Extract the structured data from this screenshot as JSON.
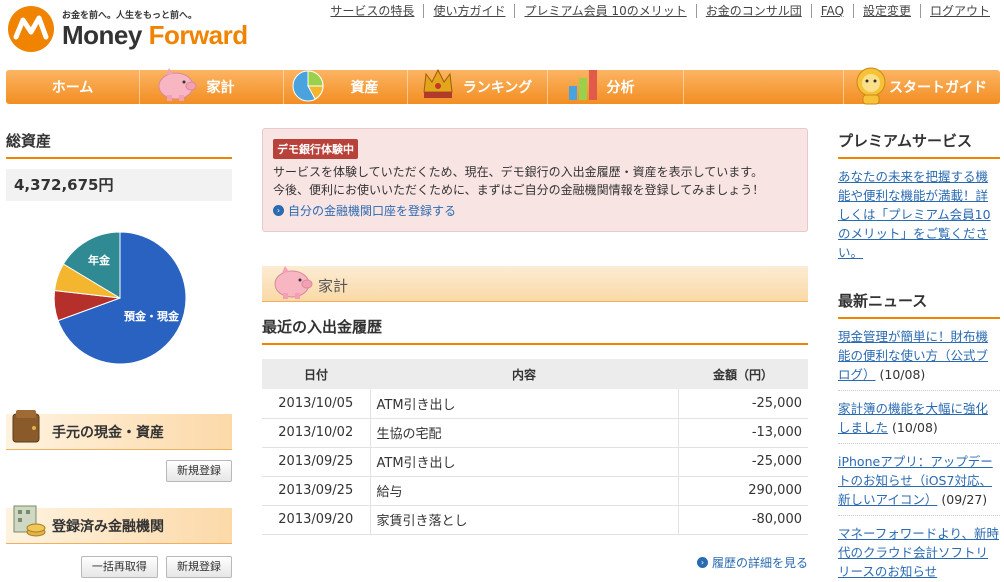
{
  "header": {
    "tagline": "お金を前へ。人生をもっと前へ。",
    "brand_money": "Money",
    "brand_forward": "Forward",
    "topnav": [
      "サービスの特長",
      "使い方ガイド",
      "プレミアム会員 10のメリット",
      "お金のコンサル団",
      "FAQ",
      "設定変更",
      "ログアウト"
    ]
  },
  "menu": {
    "home": "ホーム",
    "kakei": "家計",
    "shisan": "資産",
    "ranking": "ランキング",
    "bunseki": "分析",
    "start_guide": "スタートガイド"
  },
  "left": {
    "total_title": "総資産",
    "total_value": "4,372,675円",
    "pie": {
      "label_deposit": "預金・現金",
      "label_pension": "年金"
    },
    "cash_title": "手元の現金・資産",
    "new_register": "新規登録",
    "institutions_title": "登録済み金融機関",
    "bulk_refetch": "一括再取得",
    "new_register2": "新規登録"
  },
  "center": {
    "badge": "デモ銀行体験中",
    "notice_line1": "サービスを体験していただくため、現在、デモ銀行の入出金履歴・資産を表示しています。",
    "notice_line2": "今後、便利にお使いいただくために、まずはご自分の金融機関情報を登録してみましょう！",
    "register_link": "自分の金融機関口座を登録する",
    "kakei_label": "家計",
    "recent_title": "最近の入出金履歴",
    "columns": {
      "date": "日付",
      "desc": "内容",
      "amount": "金額（円）"
    },
    "rows": [
      {
        "date": "2013/10/05",
        "desc": "ATM引き出し",
        "amount": "-25,000"
      },
      {
        "date": "2013/10/02",
        "desc": "生協の宅配",
        "amount": "-13,000"
      },
      {
        "date": "2013/09/25",
        "desc": "ATM引き出し",
        "amount": "-25,000"
      },
      {
        "date": "2013/09/25",
        "desc": "給与",
        "amount": "290,000"
      },
      {
        "date": "2013/09/20",
        "desc": "家賃引き落とし",
        "amount": "-80,000"
      }
    ],
    "more_link": "履歴の詳細を見る"
  },
  "right": {
    "premium_title": "プレミアムサービス",
    "premium_text": "あなたの未来を把握する機能や便利な機能が満載！詳しくは「プレミアム会員10のメリット」をご覧ください。",
    "news_title": "最新ニュース",
    "news": [
      {
        "title": "現金管理が簡単に！財布機能の便利な使い方（公式ブログ）",
        "date": "(10/08)"
      },
      {
        "title": "家計簿の機能を大幅に強化しました",
        "date": "(10/08)"
      },
      {
        "title": "iPhoneアプリ：アップデートのお知らせ（iOS7対応、新しいアイコン）",
        "date": "(09/27)"
      },
      {
        "title": "マネーフォワードより、新時代のクラウド会計ソフトリリースのお知らせ",
        "date": ""
      }
    ]
  },
  "colors": {
    "brand_orange": "#f08300",
    "link_blue": "#2a6ab1",
    "pie_deposit": "#2a62c1",
    "pie_red": "#b5302b",
    "pie_yellow": "#f3b62e",
    "pie_teal": "#2f8a93"
  }
}
